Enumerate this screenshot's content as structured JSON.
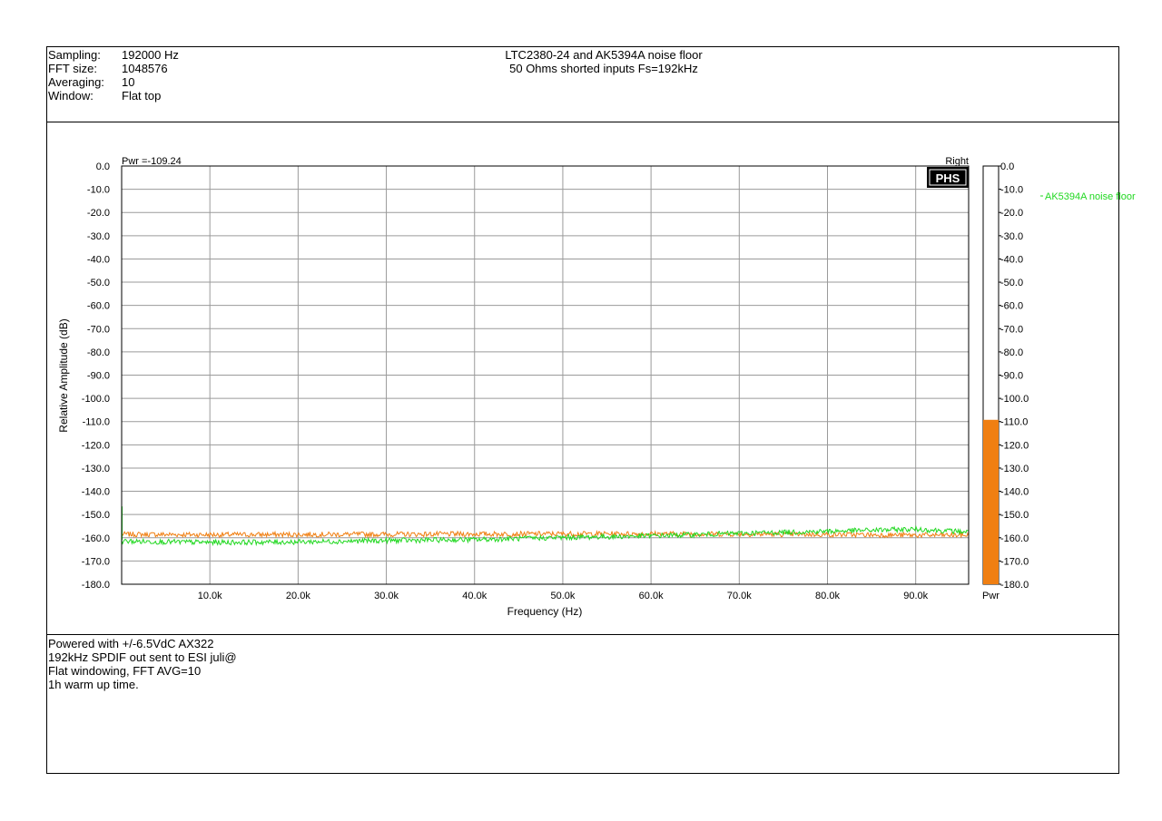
{
  "header": {
    "meta": [
      {
        "key": "Sampling:",
        "value": "192000 Hz"
      },
      {
        "key": "FFT size:",
        "value": "1048576"
      },
      {
        "key": "Averaging:",
        "value": "10"
      },
      {
        "key": "Window:",
        "value": "Flat top"
      }
    ],
    "title_line1": "LTC2380-24  and AK5394A noise floor",
    "title_line2": "50 Ohms shorted inputs Fs=192kHz"
  },
  "notes": [
    "Powered with +/-6.5VdC AX322",
    "192kHz SPDIF out sent to ESI juli@",
    "Flat windowing, FFT AVG=10",
    "1h warm up time."
  ],
  "chart_data": {
    "type": "line",
    "title": "",
    "xlabel": "Frequency (Hz)",
    "ylabel": "Relative Amplitude (dB)",
    "xlim": [
      0,
      96000
    ],
    "ylim": [
      -180,
      0
    ],
    "x_ticks": [
      10000,
      20000,
      30000,
      40000,
      50000,
      60000,
      70000,
      80000,
      90000
    ],
    "x_tick_labels": [
      "10.0k",
      "20.0k",
      "30.0k",
      "40.0k",
      "50.0k",
      "60.0k",
      "70.0k",
      "80.0k",
      "90.0k"
    ],
    "y_ticks": [
      0,
      -10,
      -20,
      -30,
      -40,
      -50,
      -60,
      -70,
      -80,
      -90,
      -100,
      -110,
      -120,
      -130,
      -140,
      -150,
      -160,
      -170,
      -180
    ],
    "y_tick_labels": [
      "0.0",
      "-10.0",
      "-20.0",
      "-30.0",
      "-40.0",
      "-50.0",
      "-60.0",
      "-70.0",
      "-80.0",
      "-90.0",
      "-100.0",
      "-110.0",
      "-120.0",
      "-130.0",
      "-140.0",
      "-150.0",
      "-160.0",
      "-170.0",
      "-180.0"
    ],
    "grid": true,
    "pwr_label": "Pwr =-109.24",
    "channel_label": "Right",
    "logo_text": "PHS",
    "series": [
      {
        "name": "",
        "color": "#f07f12",
        "x": [
          0,
          10000,
          20000,
          30000,
          40000,
          50000,
          60000,
          70000,
          80000,
          90000,
          96000
        ],
        "y": [
          -158.5,
          -158.7,
          -158.6,
          -158.5,
          -158.4,
          -158.3,
          -158.3,
          -158.4,
          -158.6,
          -158.9,
          -158.9
        ]
      },
      {
        "name": "AK5394A noise floor",
        "color": "#22d822",
        "x": [
          0,
          10000,
          20000,
          30000,
          40000,
          50000,
          60000,
          70000,
          80000,
          90000,
          96000
        ],
        "y": [
          -161.5,
          -162.0,
          -161.8,
          -161.2,
          -160.8,
          -159.9,
          -159.2,
          -158.1,
          -157.2,
          -156.3,
          -157.5
        ]
      }
    ],
    "legend": {
      "position": "right",
      "label": "AK5394A noise floor",
      "color": "#22d822"
    },
    "power_meter": {
      "level_db": -109.24,
      "range": [
        -180,
        0
      ],
      "color": "#f07f12",
      "label": "Pwr",
      "tick_labels": [
        "0.0",
        "-10.0",
        "-20.0",
        "-30.0",
        "-40.0",
        "-50.0",
        "-60.0",
        "-70.0",
        "-80.0",
        "-90.0",
        "-100.0",
        "-110.0",
        "-120.0",
        "-130.0",
        "-140.0",
        "-150.0",
        "-160.0",
        "-170.0",
        "-180.0"
      ]
    }
  }
}
